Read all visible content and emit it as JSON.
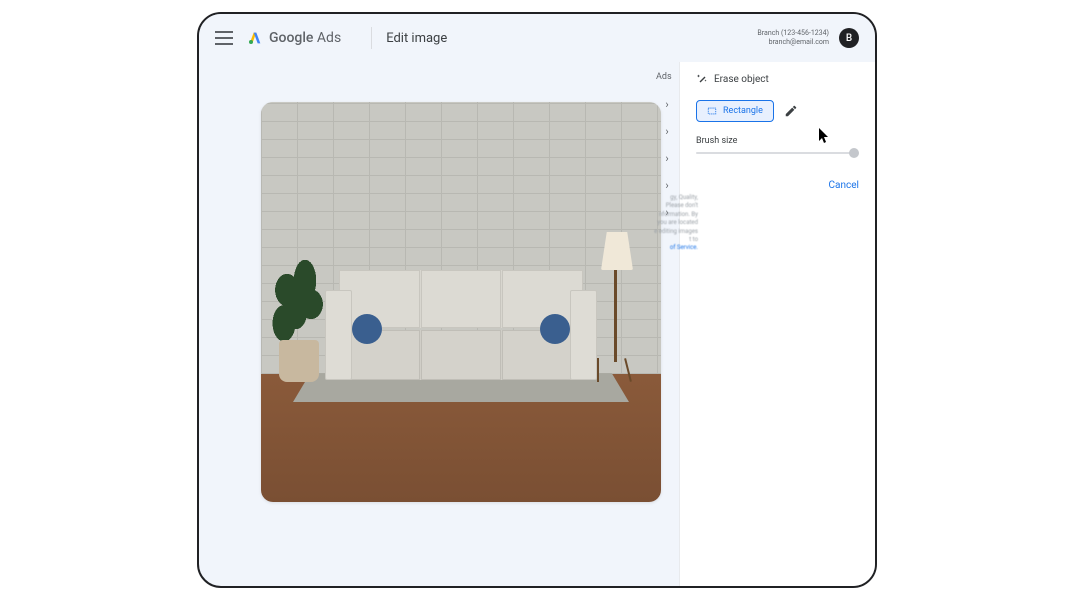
{
  "header": {
    "logo_name": "Google",
    "logo_suffix": "Ads",
    "page_title": "Edit image",
    "account_name": "Branch (123-456-1234)",
    "account_email": "branch@email.com",
    "avatar_letter": "B"
  },
  "side_panel": {
    "ads_label": "Ads",
    "title": "Erase object",
    "rectangle_label": "Rectangle",
    "brush_label": "Brush size",
    "cancel_label": "Cancel"
  },
  "ghost": {
    "line1": "gy, Quality,",
    "line2": "Please don't",
    "line3": "nformation. By",
    "line4": "you are located",
    "line5": "e editing images",
    "line6": "t to",
    "line7": "of Service."
  },
  "colors": {
    "primary_blue": "#1a73e8"
  }
}
